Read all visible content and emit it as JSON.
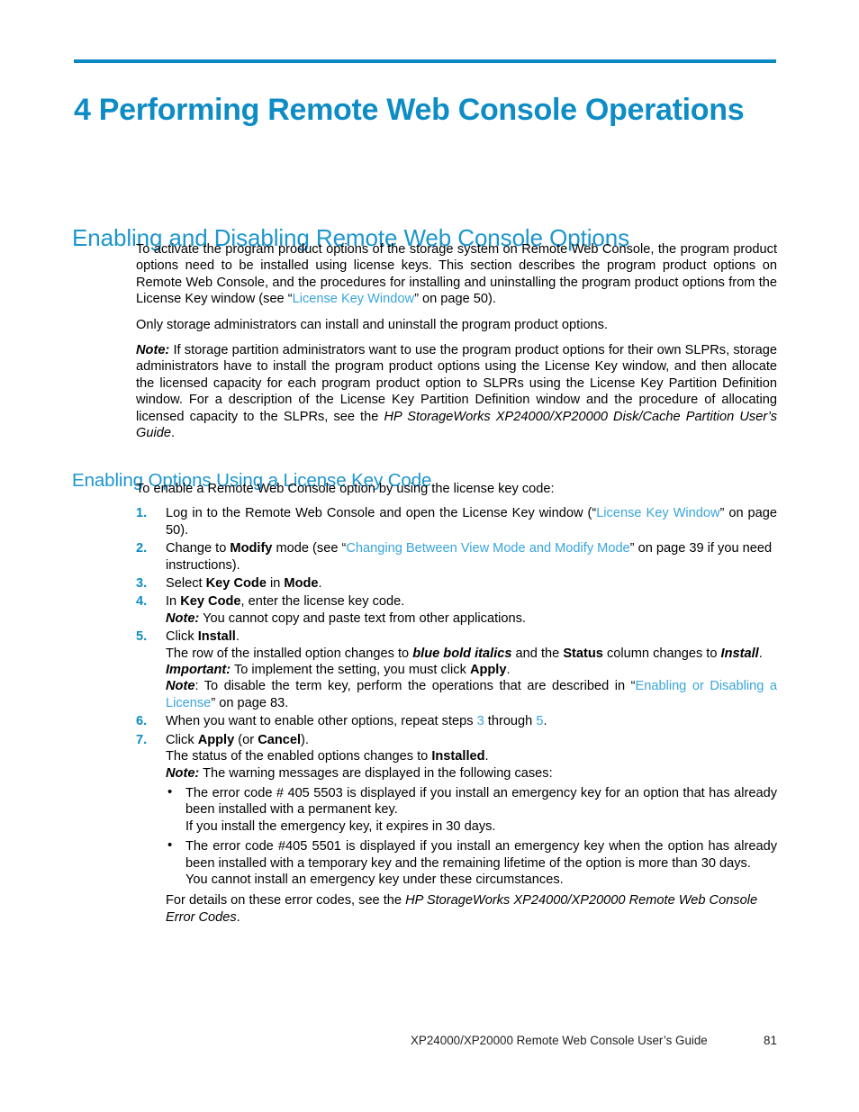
{
  "document": {
    "chapter_title": "4 Performing Remote Web Console Operations",
    "footer_title": "XP24000/XP20000 Remote Web Console User’s Guide",
    "footer_page": "81"
  },
  "colors": {
    "chapter_blue": "#0d8cc5",
    "heading_blue": "#1c96ce",
    "link_blue": "#38a5dc",
    "rule_blue": "#0b88c2",
    "body_black": "#000000"
  },
  "section": {
    "heading": "Enabling and Disabling Remote Web Console Options",
    "intro_p1_a": "To activate the program product options of the storage system on Remote Web Console, the program product options need to be installed using license keys.  This section describes the program product options on Remote Web Console, and the procedures for installing and uninstalling the program product options from the License Key window (see “",
    "intro_p1_link": "License Key Window",
    "intro_p1_b": "” on page 50).",
    "intro_p2": "Only storage administrators can install and uninstall the program product options.",
    "note_label": "Note:",
    "note_body_a": " If storage partition administrators want to use the program product options for their own SLPRs, storage administrators have to install the program product options using the License Key window, and then allocate the licensed capacity for each program product option to SLPRs using the License Key Partition Definition window.  For a description of the License Key Partition Definition window and the procedure of allocating licensed capacity to the SLPRs, see the ",
    "note_body_italic": "HP StorageWorks XP24000/XP20000 Disk/Cache Partition User’s Guide",
    "note_body_b": "."
  },
  "subsection": {
    "heading": "Enabling Options Using a License Key Code",
    "intro": "To enable a Remote Web Console option by using the license key code:",
    "steps": [
      {
        "num": "1.",
        "text_a": "Log in to the Remote Web Console and open the License Key window (“",
        "link": "License Key Window",
        "text_b": "” on page 50)."
      },
      {
        "num": "2.",
        "text_a": "Change to ",
        "bold1": "Modify",
        "text_b": " mode (see “",
        "link": "Changing Between View Mode and Modify Mode",
        "text_c": "” on page 39 if you need instructions)."
      },
      {
        "num": "3.",
        "text_a": "Select ",
        "bold1": "Key Code",
        "text_b": " in ",
        "bold2": "Mode",
        "text_c": "."
      },
      {
        "num": "4.",
        "text_a": "In ",
        "bold1": "Key Code",
        "text_b": ", enter the license key code.",
        "note_label": "Note:",
        "note_text": " You cannot copy and paste text from other applications."
      },
      {
        "num": "5.",
        "text_a": "Click ",
        "bold1": "Install",
        "text_b": ".",
        "line2_a": "The row of the installed option changes to ",
        "line2_bolditalic": "blue bold italics",
        "line2_b": " and the ",
        "line2_bold2": "Status",
        "line2_c": " column changes to ",
        "line2_italic2": "Install",
        "line2_d": ".",
        "important_label": "Important:",
        "important_text_a": " To implement the setting, you must click ",
        "important_bold": "Apply",
        "important_text_b": ".",
        "note_label": "Note",
        "note_text_a": ":  To disable the term key, perform the operations that are described in “",
        "note_link": "Enabling or Disabling a License",
        "note_text_b": "” on page 83."
      },
      {
        "num": "6.",
        "text_a": "When you want to enable other options, repeat steps ",
        "ref1": "3",
        "text_b": " through ",
        "ref2": "5",
        "text_c": "."
      },
      {
        "num": "7.",
        "text_a": "Click ",
        "bold1": "Apply",
        "text_b": " (or ",
        "bold2": "Cancel",
        "text_c": ").",
        "line2_a": "The status of the enabled options changes to ",
        "line2_bold": "Installed",
        "line2_b": ".",
        "note_label": "Note:",
        "note_text": " The warning messages are displayed in the following cases:",
        "bullets": [
          {
            "line1": "The error code # 405 5503 is displayed if you install an emergency key for an option that has already been installed with a permanent key.",
            "line2": "If you install the emergency key, it expires in 30 days."
          },
          {
            "line1": "The error code #405 5501 is displayed if you install an emergency key when the option has already been installed with a temporary key and the remaining lifetime of the option is more than 30 days.",
            "line2": "You cannot install an emergency key under these circumstances."
          }
        ],
        "closing_a": "For details on these error codes, see the ",
        "closing_italic": "HP StorageWorks XP24000/XP20000 Remote Web Console Error Codes",
        "closing_b": "."
      }
    ]
  }
}
